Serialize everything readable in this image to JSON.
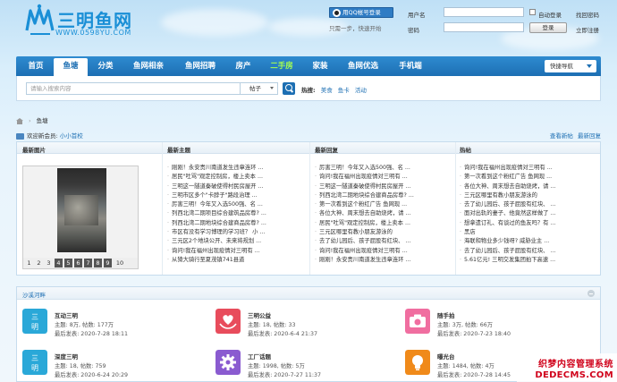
{
  "logo": {
    "text": "三明鱼网",
    "url": "WWW.0598YU.COM"
  },
  "qq": {
    "button": "用QQ帐号登录",
    "tip": "只需一步，快速开始"
  },
  "login": {
    "username_label": "用户名",
    "password_label": "密码",
    "remember": "自动登录",
    "forgot": "找回密码",
    "register": "立即注册",
    "submit": "登录"
  },
  "nav": {
    "items": [
      "首页",
      "鱼塘",
      "分类",
      "鱼网相亲",
      "鱼网招聘",
      "房产",
      "二手房",
      "家装",
      "鱼网优选",
      "手机端"
    ],
    "active": "鱼塘",
    "quick": "快捷导航"
  },
  "search": {
    "placeholder": "请输入搜索内容",
    "type": "帖子",
    "hot_label": "热搜:",
    "hot_words": [
      "美食",
      "鱼卡",
      "活动"
    ]
  },
  "breadcrumb": {
    "current": "鱼塘"
  },
  "welcome": {
    "prefix": "欢迎新会员: ",
    "name": "小小首校"
  },
  "toplinks": {
    "new_posts": "查看新帖",
    "new_replies": "最新回复"
  },
  "panel": {
    "titles": [
      "最新图片",
      "最新主题",
      "最新回复",
      "热帖"
    ],
    "pic_numbers": [
      "1",
      "2",
      "3",
      "4",
      "5",
      "6",
      "7",
      "8",
      "9",
      "10"
    ],
    "latest_topics": [
      "刚刚！永安贵川南道发生违章连环 ...",
      "居民\"吐骂\"观定控制房，楼上卖本 ...",
      "三明这一隧道秦破使得村民房屋开 ...",
      "三明市区多个\"卡脖子\"路段治理 ...",
      "厉害三明！今年又入选500强、名 ...",
      "列西北湾二期项目综合建筑品房尊? ...",
      "列西北湾二期地块综合建商品房尊? ...",
      "市区有没有学习博理的学习班？ 小 ...",
      "三元区2个地块公开、未来将规划 ...",
      "询问!我在福州出现疫情对三明有 ...",
      "从猗大骑行至夏茂镇741县道"
    ],
    "latest_replies": [
      "厉害三明！今年又入选500强、名 ...",
      "询问!我在福州出现疫情对三明有 ...",
      "三明这一隧道秦破使得村民房屋开 ...",
      "列西北湾二期地块综合建商品房尊? ...",
      "第一次看到这个粉红广告 鱼网现 ...",
      "各位大神、周末想去自助烧烤，请 ...",
      "居民\"吐骂\"观定控制房，楼上卖本 ...",
      "三元区哪里有教小朋友游泳的",
      "去了幼儿园后、孩子屁股有红块、 ...",
      "询问!我在福州出现疫情对三明有 ...",
      "刚刚！永安贵川南道发生违章连环 ..."
    ],
    "hot_posts": [
      "询问!我在福州出现疫情对三明有 ...",
      "第一次看到这个粉红广告 鱼网现 ...",
      "各位大神、周末想去自助烧烤，请 ...",
      "三元区哪里有教小朋友游泳的",
      "去了幼儿园后、孩子屁股有红块、 ...",
      "面对出轨的妻子、他竟然这样做了 ...",
      "想拿遗订礼、有谈过的鱼友吗？有 ...",
      "黑店",
      "海联和物业多少钱呀? 威胁业主 ...",
      "去了幼儿园后、孩子屁股有红块、 ...",
      "5.61亿元! 三明交发集团拍下高速 ..."
    ]
  },
  "group": {
    "title": "沙溪河畔",
    "forums": [
      {
        "name": "互动三明",
        "stat": "主题: 8万, 帖数: 177万",
        "last": "最后发表: 2020-7-28 18:11",
        "icon": "sanming-icon",
        "color": "#2aa8d8"
      },
      {
        "name": "三明公益",
        "stat": "主题: 18, 帖数: 33",
        "last": "最后发表: 2020-6-4 21:37",
        "icon": "heart-hands-icon",
        "color": "#e84c5c"
      },
      {
        "name": "随手拍",
        "stat": "主题: 3万, 帖数: 66万",
        "last": "最后发表: 2020-7-23 18:40",
        "icon": "camera-icon",
        "color": "#f06ea0"
      },
      {
        "name": "深度三明",
        "stat": "主题: 18, 帖数: 759",
        "last": "最后发表: 2020-6-24 20:29",
        "icon": "sanming-icon",
        "color": "#2aa8d8"
      },
      {
        "name": "工厂话题",
        "stat": "主题: 1998, 帖数: 5万",
        "last": "最后发表: 2020-7-27 11:37",
        "icon": "gear-icon",
        "color": "#8a5bd0"
      },
      {
        "name": "曝光台",
        "stat": "主题: 1484, 帖数: 4万",
        "last": "最后发表: 2020-7-28 14:45",
        "icon": "bulb-icon",
        "color": "#f08a1a"
      }
    ]
  },
  "watermark": {
    "line1": "织梦内容管理系统",
    "line2": "DEDECMS.COM"
  }
}
